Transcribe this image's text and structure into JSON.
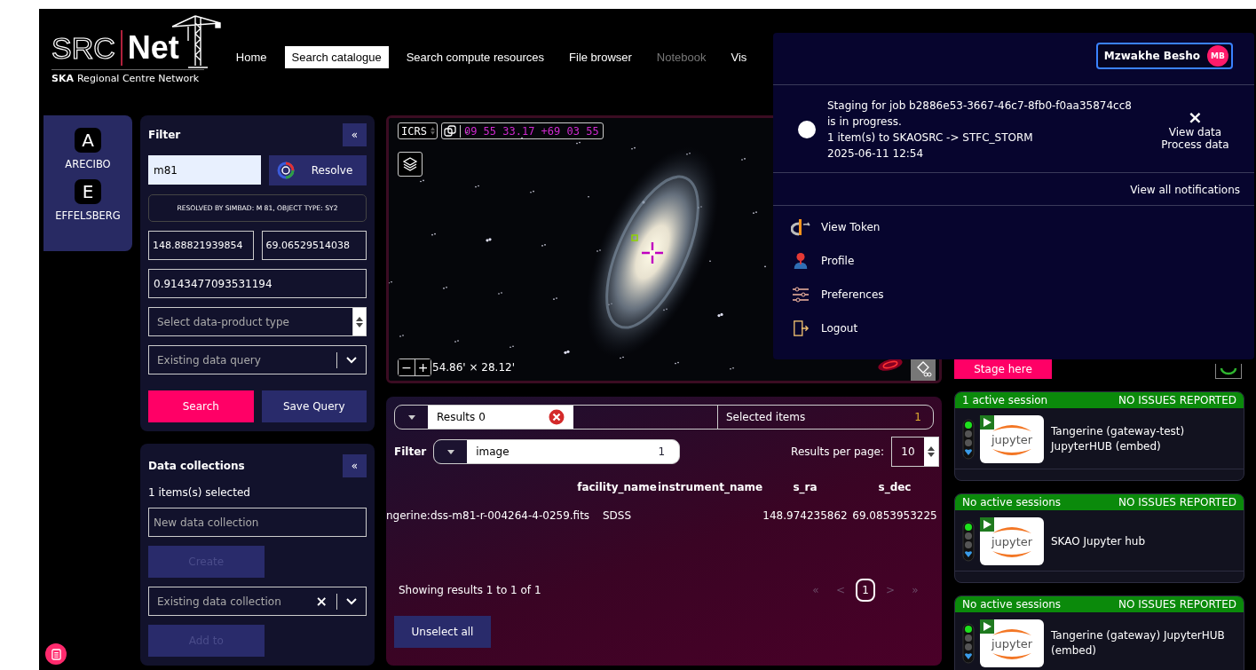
{
  "header": {
    "logo": {
      "left": "SRC",
      "right": "Net",
      "org": "SKA",
      "subtitle": "Regional Centre Network"
    },
    "nav": [
      {
        "label": "Home",
        "selected": false,
        "disabled": false
      },
      {
        "label": "Search catalogue",
        "selected": true,
        "disabled": false
      },
      {
        "label": "Search compute resources",
        "selected": false,
        "disabled": false
      },
      {
        "label": "File browser",
        "selected": false,
        "disabled": false
      },
      {
        "label": "Notebook",
        "selected": false,
        "disabled": true
      },
      {
        "label": "Vis",
        "selected": false,
        "disabled": false
      }
    ]
  },
  "facilities": [
    {
      "letter": "A",
      "name": "ARECIBO"
    },
    {
      "letter": "E",
      "name": "EFFELSBERG"
    }
  ],
  "filter": {
    "title": "Filter",
    "collapse": "«",
    "target": "m81",
    "resolve": "Resolve",
    "resolved": "RESOLVED BY SIMBAD: M 81, OBJECT TYPE: SY2",
    "ra": "148.88821939854",
    "dec": "69.06529514038",
    "radius": "0.9143477093531194",
    "product_type_placeholder": "Select data-product type",
    "query_placeholder": "Existing data query",
    "search": "Search",
    "save": "Save Query"
  },
  "collections": {
    "title": "Data collections",
    "collapse": "«",
    "selected_count": "1 items(s) selected",
    "new_placeholder": "New data collection",
    "create": {
      "label": "Create",
      "disabled": true
    },
    "existing_placeholder": "Existing data collection",
    "clear": "×",
    "add": {
      "label": "Add to",
      "disabled": true
    }
  },
  "sky": {
    "frame": "ICRS",
    "coords": "09 55 33.17 +69 03 55",
    "zoom_out": "−",
    "zoom_in": "+",
    "fov": "54.86' × 28.12'"
  },
  "results": {
    "tab": "Results 0",
    "selected_label": "Selected items",
    "selected_count": "1",
    "filter_label": "Filter",
    "filter_value": "image",
    "filter_count": "1",
    "per_page_label": "Results per page:",
    "per_page": "10",
    "columns": [
      "facility_name",
      "instrument_name",
      "s_ra",
      "s_dec"
    ],
    "rows": [
      {
        "column_1": "ngerine:dss-m81-r-004264-4-0259.fits",
        "facility_name": "SDSS",
        "s_ra": "148.974235862",
        "s_dec": "69.0853953225"
      }
    ],
    "summary": "Showing results 1 to 1 of 1",
    "pages": [
      {
        "label": "«",
        "selected": false,
        "disabled": true
      },
      {
        "label": "<",
        "selected": false,
        "disabled": true
      },
      {
        "label": "1",
        "selected": true,
        "disabled": false
      },
      {
        "label": ">",
        "selected": false,
        "disabled": true
      },
      {
        "label": "»",
        "selected": false,
        "disabled": true
      }
    ],
    "unselect": "Unselect all"
  },
  "staging": {
    "stage": "Stage here"
  },
  "sessions": [
    {
      "status": "1 active session",
      "health": "NO ISSUES REPORTED",
      "logo_text": "jupyter",
      "name": "Tangerine (gateway-test) JupyterHUB (embed)"
    },
    {
      "status": "No active sessions",
      "health": "NO ISSUES REPORTED",
      "logo_text": "jupyter",
      "name": "SKAO Jupyter hub"
    },
    {
      "status": "No active sessions",
      "health": "NO ISSUES REPORTED",
      "logo_text": "jupyter",
      "name": "Tangerine (gateway) JupyterHUB (embed)"
    }
  ],
  "account_menu": {
    "user": "Mzwakhe Besho",
    "initials": "MB",
    "notification": {
      "message": "Staging for job b2886e53-3667-46c7-8fb0-f0aa35874cc8 is in progress.",
      "detail": "1 item(s) to SKAOSRC -> STFC_STORM",
      "time": "2025-06-11 12:54",
      "close": "×",
      "actions": [
        "View data",
        "Process data"
      ]
    },
    "view_all": "View all notifications",
    "items": [
      {
        "kind": "token",
        "label": "View Token"
      },
      {
        "kind": "profile",
        "label": "Profile"
      },
      {
        "kind": "preferences",
        "label": "Preferences"
      },
      {
        "kind": "logout",
        "label": "Logout"
      }
    ]
  }
}
